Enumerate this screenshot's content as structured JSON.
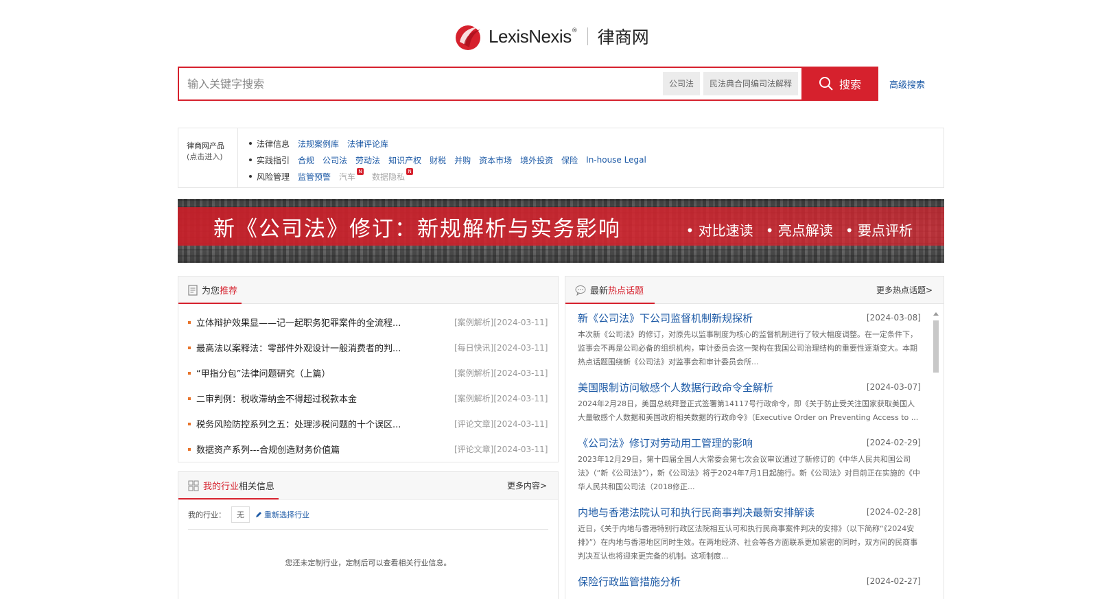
{
  "logo": {
    "brand": "LexisNexis",
    "reg": "®",
    "site": "律商网"
  },
  "search": {
    "placeholder": "输入关键字搜索",
    "tags": [
      "公司法",
      "民法典合同编司法解释"
    ],
    "button": "搜索",
    "advanced": "高级搜索"
  },
  "products": {
    "label": "律商网产品",
    "sublabel": "(点击进入)",
    "rows": [
      {
        "cat": "法律信息",
        "links": [
          "法规案例库",
          "法律评论库"
        ]
      },
      {
        "cat": "实践指引",
        "links": [
          "合规",
          "公司法",
          "劳动法",
          "知识产权",
          "财税",
          "并购",
          "资本市场",
          "境外投资",
          "保险",
          "In-house Legal"
        ]
      },
      {
        "cat": "风险管理",
        "links": [
          "监管预警",
          "汽车",
          "数据隐私"
        ],
        "new_badge": "N"
      }
    ]
  },
  "banner": {
    "title": "新《公司法》修订：新规解析与实务影响",
    "points": [
      "对比速读",
      "亮点解读",
      "要点评析"
    ]
  },
  "recommend": {
    "title_a": "为您",
    "title_b": "推荐",
    "items": [
      {
        "title": "立体辩护效果显——记一起职务犯罪案件的全流程...",
        "meta": "[案例解析][2024-03-11]"
      },
      {
        "title": "最高法以案释法：零部件外观设计一般消费者的判...",
        "meta": "[每日快讯][2024-03-11]"
      },
      {
        "title": "“甲指分包”法律问题研究（上篇）",
        "meta": "[案例解析][2024-03-11]"
      },
      {
        "title": "二审判例：税收滞纳金不得超过税款本金",
        "meta": "[案例解析][2024-03-11]"
      },
      {
        "title": "税务风险防控系列之五：处理涉税问题的十个误区...",
        "meta": "[评论文章][2024-03-11]"
      },
      {
        "title": "数据资产系列---合规创造财务价值篇",
        "meta": "[评论文章][2024-03-11]"
      }
    ]
  },
  "industry": {
    "title_a": "我的行业",
    "title_b": "相关信息",
    "more": "更多内容>",
    "label": "我的行业：",
    "value": "无",
    "reselect": "重新选择行业",
    "empty": "您还未定制行业，定制后可以查看相关行业信息。"
  },
  "hot": {
    "title_a": "最新",
    "title_b": "热点话题",
    "more": "更多热点话题>",
    "items": [
      {
        "title": "新《公司法》下公司监督机制新规探析",
        "date": "[2024-03-08]",
        "summary": "本次新《公司法》的修订，对原先以监事制度为核心的监督机制进行了较大幅度调整。在一定条件下，监事会不再是公司必备的组织机构，审计委员会这一架构在我国公司治理结构的重要性逐渐变大。本期热点话题围绕新《公司法》对监事会和审计委员会所..."
      },
      {
        "title": "美国限制访问敏感个人数据行政命令全解析",
        "date": "[2024-03-07]",
        "summary": "2024年2月28日，美国总统拜登正式签署第14117号行政命令，即《关于防止受关注国家获取美国人大量敏感个人数据和美国政府相关数据的行政命令》（Executive Order on Preventing Access to ..."
      },
      {
        "title": "《公司法》修订对劳动用工管理的影响",
        "date": "[2024-02-29]",
        "summary": "2023年12月29日，第十四届全国人大常委会第七次会议审议通过了新修订的《中华人民共和国公司法》（“新《公司法》”），新《公司法》将于2024年7月1日起施行。新《公司法》对目前正在实施的《中华人民共和国公司法（2018修正..."
      },
      {
        "title": "内地与香港法院认可和执行民商事判决最新安排解读",
        "date": "[2024-02-28]",
        "summary": "近日，《关于内地与香港特别行政区法院相互认可和执行民商事案件判决的安排》（以下简称“《2024安排》”）在内地与香港地区同时生效。在两地经济、社会等各方面联系更加紧密的同时，双方间的民商事判决互认也将迎来更完备的机制。这项制度..."
      },
      {
        "title": "保险行政监管措施分析",
        "date": "[2024-02-27]",
        "summary": ""
      }
    ]
  },
  "colors": {
    "brand_red": "#d6212d",
    "link_blue": "#1d5aa6"
  }
}
